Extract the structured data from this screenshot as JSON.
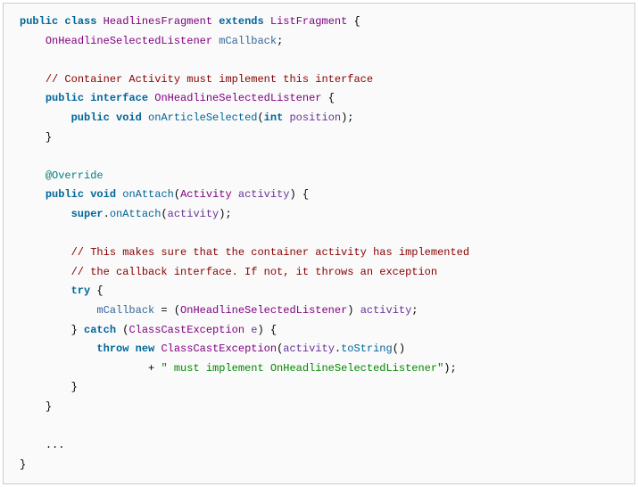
{
  "code": {
    "kw": {
      "public": "public",
      "class": "class",
      "extends": "extends",
      "interface": "interface",
      "void": "void",
      "int": "int",
      "super": "super",
      "try": "try",
      "catch": "catch",
      "throw": "throw",
      "new": "new"
    },
    "cls": {
      "HeadlinesFragment": "HeadlinesFragment",
      "ListFragment": "ListFragment",
      "OnHeadlineSelectedListener": "OnHeadlineSelectedListener",
      "Activity": "Activity",
      "ClassCastException": "ClassCastException"
    },
    "member": {
      "mCallback": "mCallback"
    },
    "ann": {
      "Override": "@Override"
    },
    "mtd": {
      "onArticleSelected": "onArticleSelected",
      "onAttach": "onAttach",
      "toString": "toString"
    },
    "com": {
      "c1": "// Container Activity must implement this interface",
      "c2": "// This makes sure that the container activity has implemented",
      "c3": "// the callback interface. If not, it throws an exception"
    },
    "str": {
      "s1": "\" must implement OnHeadlineSelectedListener\""
    },
    "txt": {
      "position": "position",
      "activity": "activity",
      "e": "e",
      "sp": " ",
      "lbrace": "{",
      "rbrace": "}",
      "lparen": "(",
      "rparen": ")",
      "semi": ";",
      "dot": ".",
      "eq": " = ",
      "plus": "+ ",
      "dots": "..."
    }
  }
}
